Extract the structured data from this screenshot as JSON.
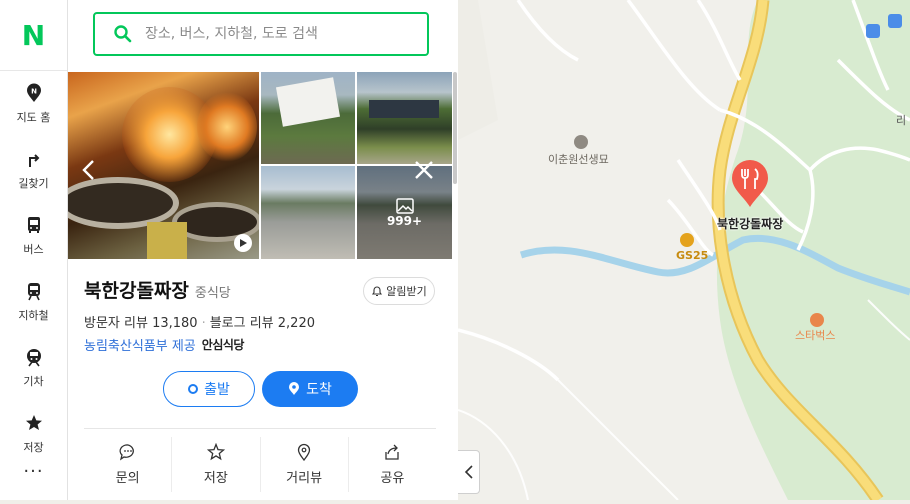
{
  "rail": {
    "logo": "N",
    "items": [
      {
        "label": "지도 홈",
        "icon": "map-home-icon"
      },
      {
        "label": "길찾기",
        "icon": "directions-icon"
      },
      {
        "label": "버스",
        "icon": "bus-icon"
      },
      {
        "label": "지하철",
        "icon": "subway-icon"
      },
      {
        "label": "기차",
        "icon": "train-icon"
      },
      {
        "label": "저장",
        "icon": "star-icon"
      }
    ],
    "more": "···"
  },
  "search": {
    "placeholder": "장소, 버스, 지하철, 도로 검색"
  },
  "photos": {
    "more_count": "999+"
  },
  "place": {
    "name": "북한강돌짜장",
    "category": "중식당",
    "alarm_label": "알림받기",
    "visitor_reviews": "방문자 리뷰 13,180",
    "blog_reviews": "블로그 리뷰 2,220",
    "certification": "농림축산식품부 제공",
    "certification_badge": "안심식당"
  },
  "buttons": {
    "start": "출발",
    "arrive": "도착"
  },
  "actions": [
    {
      "label": "문의",
      "icon": "chat-icon"
    },
    {
      "label": "저장",
      "icon": "star-outline-icon"
    },
    {
      "label": "거리뷰",
      "icon": "street-view-icon"
    },
    {
      "label": "공유",
      "icon": "share-icon"
    }
  ],
  "map": {
    "labels": {
      "grave": "이춘원선생묘",
      "gs25": "GS25",
      "restaurant": "북한강돌짜장",
      "starbucks": "스타벅스",
      "edge": "리"
    },
    "colors": {
      "pin": "#f15a4a",
      "road_main": "#f6d36a",
      "river": "#9ccde6",
      "park": "#d7ecd0",
      "starbucks": "#e9864b",
      "gs25": "#e4a21c"
    }
  }
}
